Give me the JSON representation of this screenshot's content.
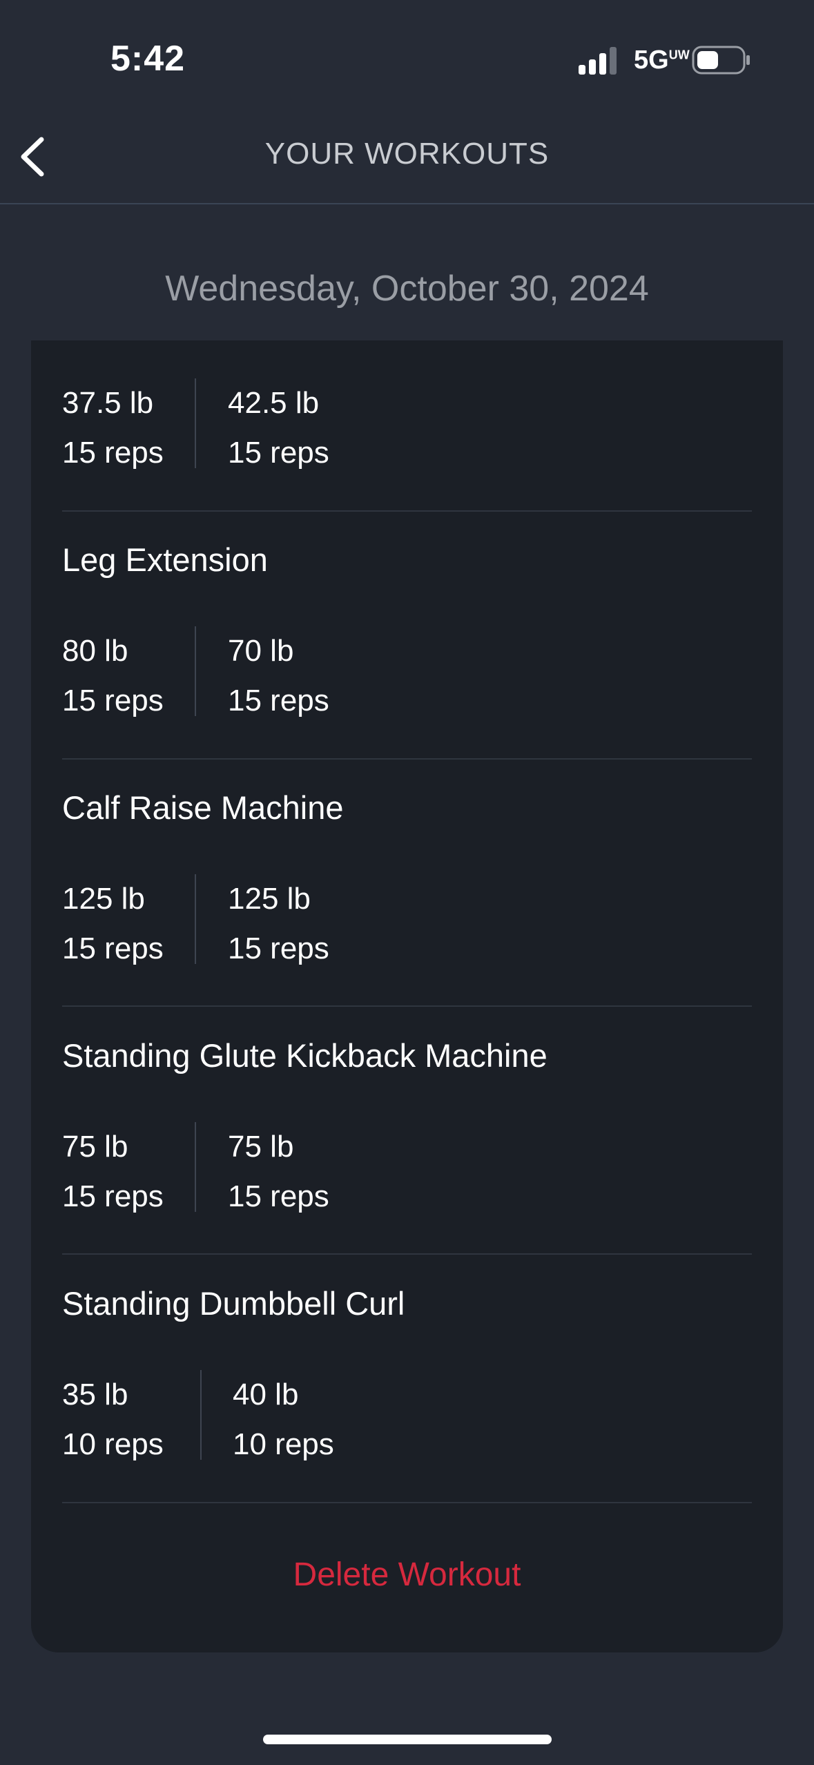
{
  "status_bar": {
    "time": "5:42",
    "network": "5G",
    "network_suffix": "UW",
    "icons": [
      "signal-icon",
      "battery-icon"
    ]
  },
  "header": {
    "title": "YOUR WORKOUTS",
    "back_icon": "chevron-left-icon"
  },
  "date": "Wednesday, October 30, 2024",
  "first_sets": [
    {
      "weight": "37.5 lb",
      "reps": "15 reps"
    },
    {
      "weight": "42.5 lb",
      "reps": "15 reps"
    }
  ],
  "exercises": [
    {
      "name": "Leg Extension",
      "sets": [
        {
          "weight": "80 lb",
          "reps": "15 reps"
        },
        {
          "weight": "70 lb",
          "reps": "15 reps"
        }
      ]
    },
    {
      "name": "Calf Raise Machine",
      "sets": [
        {
          "weight": "125 lb",
          "reps": "15 reps"
        },
        {
          "weight": "125 lb",
          "reps": "15 reps"
        }
      ]
    },
    {
      "name": "Standing Glute Kickback Machine",
      "sets": [
        {
          "weight": "75 lb",
          "reps": "15 reps"
        },
        {
          "weight": "75 lb",
          "reps": "15 reps"
        }
      ]
    },
    {
      "name": "Standing Dumbbell Curl",
      "sets": [
        {
          "weight": "35 lb",
          "reps": "10 reps"
        },
        {
          "weight": "40 lb",
          "reps": "10 reps"
        }
      ]
    }
  ],
  "actions": {
    "delete_label": "Delete Workout"
  },
  "colors": {
    "background": "#262b36",
    "card": "#1b1f26",
    "delete": "#d6293e"
  }
}
